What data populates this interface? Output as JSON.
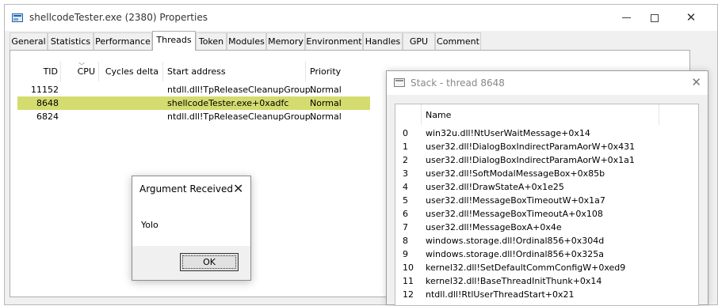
{
  "window": {
    "title": "shellcodeTester.exe (2380) Properties",
    "icon": "window-app-icon",
    "controls": [
      "minimize-icon",
      "maximize-icon",
      "close-icon"
    ]
  },
  "tabs": [
    {
      "label": "General"
    },
    {
      "label": "Statistics"
    },
    {
      "label": "Performance"
    },
    {
      "label": "Threads",
      "active": true
    },
    {
      "label": "Token"
    },
    {
      "label": "Modules"
    },
    {
      "label": "Memory"
    },
    {
      "label": "Environment"
    },
    {
      "label": "Handles"
    },
    {
      "label": "GPU"
    },
    {
      "label": "Comment"
    }
  ],
  "threads": {
    "columns": {
      "tid": "TID",
      "cpu": "CPU",
      "cycles": "Cycles delta",
      "start": "Start address",
      "priority": "Priority"
    },
    "sorted_column": "cpu",
    "rows": [
      {
        "tid": "11152",
        "cpu": "",
        "cycles": "",
        "start": "ntdll.dll!TpReleaseCleanupGroup...",
        "priority": "Normal",
        "selected": false
      },
      {
        "tid": "8648",
        "cpu": "",
        "cycles": "",
        "start": "shellcodeTester.exe+0xadfc",
        "priority": "Normal",
        "selected": true
      },
      {
        "tid": "6824",
        "cpu": "",
        "cycles": "",
        "start": "ntdll.dll!TpReleaseCleanupGroup...",
        "priority": "Normal",
        "selected": false
      }
    ],
    "highlight_color": "#d4dc6f"
  },
  "stack": {
    "title": "Stack - thread 8648",
    "icon": "window-app-icon",
    "column_name": "Name",
    "frames": [
      {
        "index": "0",
        "name": "win32u.dll!NtUserWaitMessage+0x14"
      },
      {
        "index": "1",
        "name": "user32.dll!DialogBoxIndirectParamAorW+0x431"
      },
      {
        "index": "2",
        "name": "user32.dll!DialogBoxIndirectParamAorW+0x1a1"
      },
      {
        "index": "3",
        "name": "user32.dll!SoftModalMessageBox+0x85b"
      },
      {
        "index": "4",
        "name": "user32.dll!DrawStateA+0x1e25"
      },
      {
        "index": "5",
        "name": "user32.dll!MessageBoxTimeoutW+0x1a7"
      },
      {
        "index": "6",
        "name": "user32.dll!MessageBoxTimeoutA+0x108"
      },
      {
        "index": "7",
        "name": "user32.dll!MessageBoxA+0x4e"
      },
      {
        "index": "8",
        "name": "windows.storage.dll!Ordinal856+0x304d"
      },
      {
        "index": "9",
        "name": "windows.storage.dll!Ordinal856+0x325a"
      },
      {
        "index": "10",
        "name": "kernel32.dll!SetDefaultCommConfigW+0xed9"
      },
      {
        "index": "11",
        "name": "kernel32.dll!BaseThreadInitThunk+0x14"
      },
      {
        "index": "12",
        "name": "ntdll.dll!RtlUserThreadStart+0x21"
      }
    ]
  },
  "dialog": {
    "title": "Argument Received",
    "message": "Yolo",
    "ok_label": "OK"
  }
}
